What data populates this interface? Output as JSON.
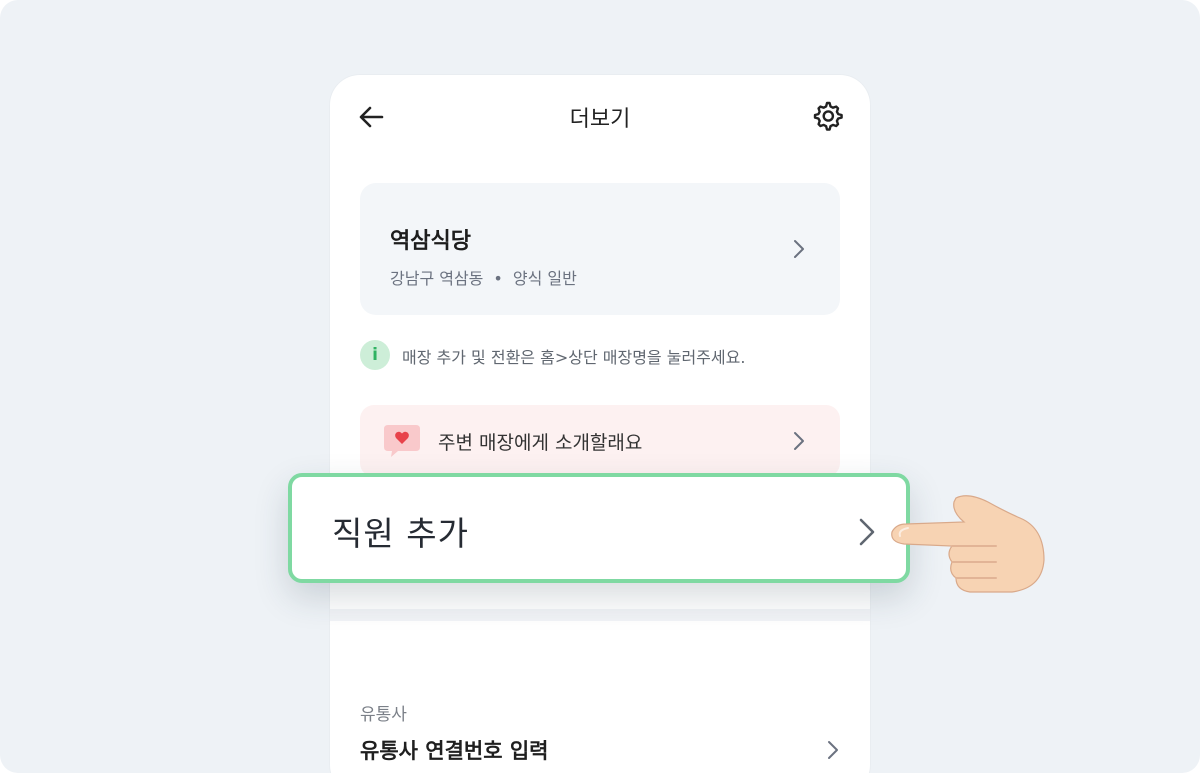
{
  "header": {
    "title": "더보기"
  },
  "store": {
    "name": "역삼식당",
    "location": "강남구 역삼동",
    "separator": "•",
    "category": "양식 일반"
  },
  "info": {
    "icon_text": "i",
    "text": "매장 추가 및 전환은 홈>상단 매장명을 눌러주세요."
  },
  "recommend": {
    "label": "주변 매장에게 소개할래요"
  },
  "highlight": {
    "label": "직원 추가"
  },
  "carrier": {
    "section_label": "유통사",
    "item_label": "유통사 연결번호 입력"
  },
  "colors": {
    "accent_border": "#7fd9a2",
    "info_green": "#2fb362",
    "heart_red": "#e8424a"
  },
  "icons": [
    "back-arrow-icon",
    "gear-icon",
    "chevron-right-icon",
    "info-icon",
    "heart-bubble-icon",
    "pointing-hand-icon"
  ]
}
